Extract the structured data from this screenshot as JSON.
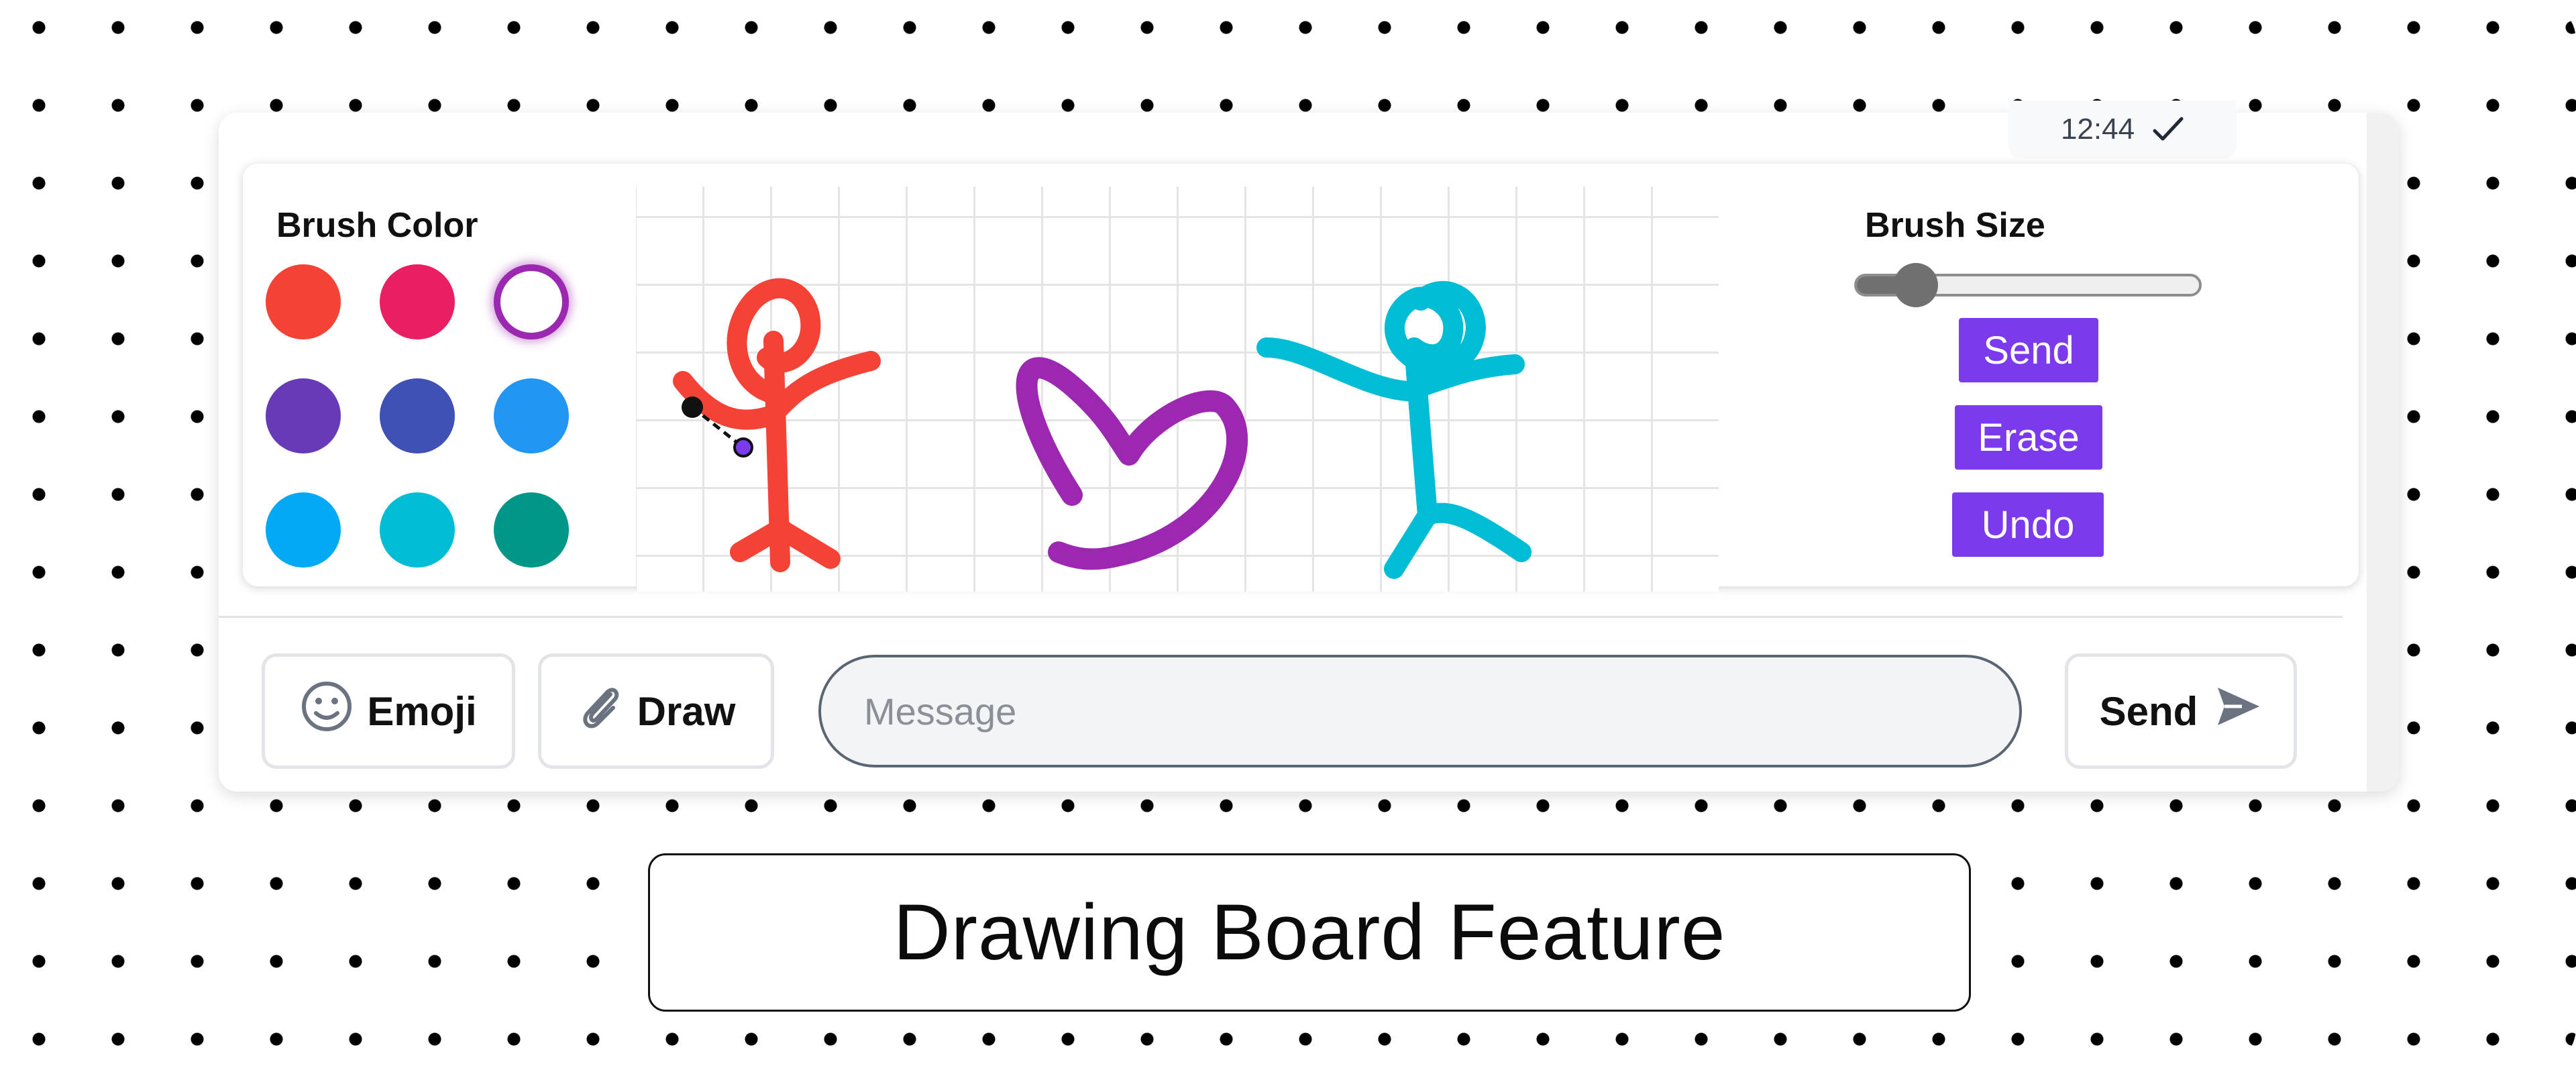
{
  "message_meta": {
    "time": "12:44",
    "status_icon": "check-icon"
  },
  "brush_color": {
    "label": "Brush Color",
    "swatches": [
      {
        "name": "red",
        "color": "#f44336",
        "selected": false
      },
      {
        "name": "pink",
        "color": "#e91e63",
        "selected": false
      },
      {
        "name": "white",
        "color": "#ffffff",
        "selected": true
      },
      {
        "name": "purple",
        "color": "#673ab7",
        "selected": false
      },
      {
        "name": "indigo",
        "color": "#3f51b5",
        "selected": false
      },
      {
        "name": "blue",
        "color": "#2196f3",
        "selected": false
      },
      {
        "name": "light-blue",
        "color": "#03a9f4",
        "selected": false
      },
      {
        "name": "cyan",
        "color": "#00bcd4",
        "selected": false
      },
      {
        "name": "teal",
        "color": "#009688",
        "selected": false
      }
    ]
  },
  "canvas": {
    "drawings": [
      {
        "name": "stick-figure-red",
        "color": "#f44336"
      },
      {
        "name": "heart-purple",
        "color": "#9c27b0"
      },
      {
        "name": "stick-figure-cyan",
        "color": "#00bcd4"
      }
    ]
  },
  "brush_size": {
    "label": "Brush Size",
    "value_fraction": 0.17
  },
  "actions": {
    "send": "Send",
    "erase": "Erase",
    "undo": "Undo"
  },
  "input_bar": {
    "emoji_label": "Emoji",
    "emoji_icon": "smiley-icon",
    "draw_label": "Draw",
    "draw_icon": "paperclip-icon",
    "message_placeholder": "Message",
    "send_label": "Send",
    "send_icon": "send-arrow-icon"
  },
  "caption": "Drawing Board Feature",
  "colors": {
    "accent": "#7c3aed",
    "selected_ring": "#9c27b0",
    "icon_gray": "#6b7280"
  }
}
